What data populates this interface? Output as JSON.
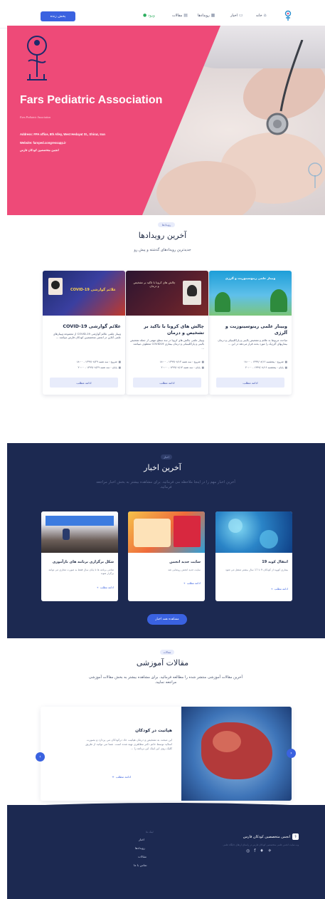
{
  "nav": {
    "live_button": "پخش زنده",
    "links": [
      {
        "label": "خانه",
        "icon": "home-icon"
      },
      {
        "label": "اخبار",
        "icon": "news-icon"
      },
      {
        "label": "رویدادها",
        "icon": "calendar-icon"
      },
      {
        "label": "مقالات",
        "icon": "article-icon"
      },
      {
        "label": "ورود",
        "icon": "login-icon"
      }
    ],
    "logo_icon": "association-logo"
  },
  "hero": {
    "script_text": "Fars Pediatric Association",
    "title": "Fars Pediatric Association",
    "address": "Address: FPA office, 8th Alley, West Hedayat St., Shiraz, Iran",
    "website": "Website: farsped.congressapp.ir",
    "fa_name": "انجمن متخصصین کودکان فارس",
    "accent_color": "#ee4a78"
  },
  "events": {
    "pill": "رویدادها",
    "title": "آخرین رویدادها",
    "subtitle": "جدیدترین رویدادهای گذشته و پیش رو",
    "cards": [
      {
        "title": "وبینار علمی رینوسینوزیت و آلرژی",
        "description": "مباحث مربوط به علائم و تشخیص بالینی و پاراکلینیکی و درمان بیماریهای آلرژیک را مورد بحث قرار می‌دهد در این ...",
        "start": "شروع : پنجشنبه ۱۳۹۹/۰۸/۱۶ - ۱۸:۰۰",
        "end": "پایان : پنجشنبه ۱۳۹۹/۰۸/۱۶ - ۲۰:۰۰",
        "button": "ادامه مطلب",
        "poster_text": "وبینار علمی رینوسینوزیت و آلرژی"
      },
      {
        "title": "چالش های کرونا با تاکید بر تشخیص و درمان",
        "description": "وبینار علمی چالش های کرونا در سه سطح مهمی از جمله تشخیص بالینی و پاراکلینیکی و درمان بیماری COVID19 معطوف میباشد ...",
        "start": "شروع : سه شنبه ۱۳۹۹/۰۸/۱۳ - ۱۸:۰۰",
        "end": "پایان : سه شنبه ۱۳۹۹/۰۸/۱۳ - ۲۰:۰۰",
        "button": "ادامه مطلب",
        "poster_text": "چالش های کرونا با تاکید بر تشخیص و درمان"
      },
      {
        "title": "علائم گوارشی COVID-19",
        "description": "وبینار علمی علائم گوارشی COVID-19 از مجموعه وبینارهای علمی آنلاین در انجمن متخصصین کودکان فارس میباشد ...",
        "start": "شروع : سه شنبه ۱۳۹۹/۰۸/۲۹ - ۱۸:۰۰",
        "end": "پایان : سه شنبه ۱۳۹۹/۰۸/۲۹ - ۲۰:۰۰",
        "button": "ادامه مطلب",
        "poster_text": "علائم گوارشی COVID-19"
      }
    ]
  },
  "news": {
    "pill": "اخبار",
    "title": "آخرین اخبار",
    "subtitle": "آخرین اخبار مهم را در اینجا ملاحظه می فرمائید. برای مشاهده بیشتر به بخش اخبار مراجعه فرمائید.",
    "cards": [
      {
        "title": "انتقال کوید 19",
        "description": "بیماری کووید از کودکان 9 تا 17 سال بیشتر منتقل می شود",
        "more": "ادامه مطلب"
      },
      {
        "title": "سایت جدید انجمن",
        "description": "سایت جدید انجمن رونمایی شد",
        "more": "ادامه مطلب"
      },
      {
        "title": "شکل برگزاری برنامه های بازآموزی",
        "description": "تمامی برنامه ها تا پایان سال فقط به صورت مجازی می توانند برگزار شوند",
        "more": "ادامه مطلب"
      }
    ],
    "all_button": "مشاهده همه اخبار"
  },
  "articles": {
    "pill": "مقالات",
    "title": "مقالات آموزشی",
    "subtitle": "آخرین مقالات آموزشی منتشر شده را مطالعه فرمائید. برای مشاهده بیشتر به بخش مقالات آموزشی مراجعه نمایید.",
    "card": {
      "title": "هپاتیت در کودکان",
      "description": "این مبحث به تشخیص و درمان هپاتیت حاد درکودکان می پردازد و بصورت اسلاید توسط خانم دکتر مظاهری تهیه شده است. شما می توانید از طریق کلیک روی این لینک این برنامه را ...",
      "more": "ادامه مطلب"
    }
  },
  "footer": {
    "org_name": "انجمن متخصصین کودکان فارس",
    "org_desc": "وب سایت انجمن علمی متخصصین کودکان فارس در راستای ارتقای جایگاه علمی",
    "links_title": "لینک ها",
    "links": [
      "اخبار",
      "رویدادها",
      "مقالات",
      "تماس با ما"
    ],
    "social_icons": [
      "instagram-icon",
      "facebook-icon",
      "twitter-icon",
      "telegram-icon"
    ]
  }
}
